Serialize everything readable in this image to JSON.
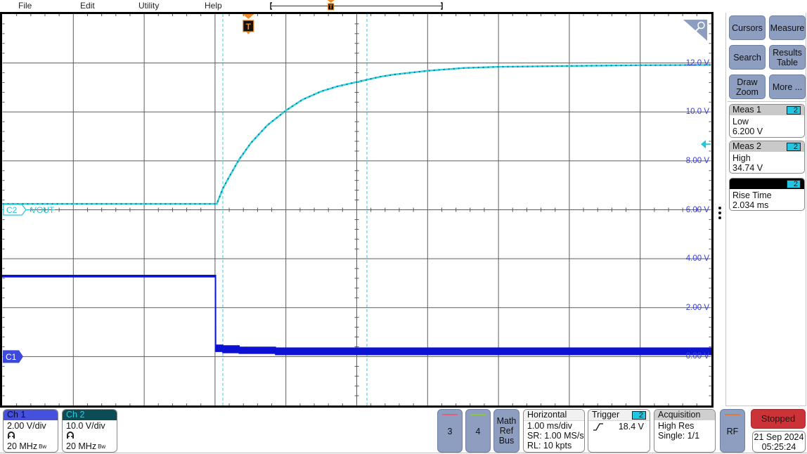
{
  "menu": {
    "file": "File",
    "edit": "Edit",
    "utility": "Utility",
    "help": "Help"
  },
  "record_view": {
    "trigger_position_pct": 35,
    "trigger_marker": "T"
  },
  "plot": {
    "trigger_marker": "T",
    "ch1_marker": "C1",
    "ch2_marker": "C2",
    "ch2_label": "VOUT",
    "zoom_icon": "magnifier-icon",
    "more_icon": "vertical-ellipsis-icon"
  },
  "side_panel": {
    "buttons": [
      {
        "label": "Cursors"
      },
      {
        "label": "Measure"
      },
      {
        "label": "Search"
      },
      {
        "label": "Results\nTable"
      },
      {
        "label": "Draw\nZoom"
      },
      {
        "label": "More ..."
      }
    ],
    "measurements": [
      {
        "title": "Meas 1",
        "source": "2",
        "type": "Low",
        "value": "6.200 V"
      },
      {
        "title": "Meas 2",
        "source": "2",
        "type": "High",
        "value": "34.74 V"
      },
      {
        "title": "",
        "source": "2",
        "type": "Rise Time",
        "value": "2.034 ms"
      }
    ]
  },
  "bottom_bar": {
    "channels": [
      {
        "label": "Ch 1",
        "scale": "2.00 V/div",
        "bandwidth": "20 MHz",
        "bw_symbol": "Bw"
      },
      {
        "label": "Ch 2",
        "scale": "10.0 V/div",
        "bandwidth": "20 MHz",
        "bw_symbol": "Bw"
      }
    ],
    "add_buttons": [
      {
        "label": "3"
      },
      {
        "label": "4"
      },
      {
        "label": "Math\nRef\nBus"
      }
    ],
    "horizontal": {
      "title": "Horizontal",
      "scale": "1.00 ms/div",
      "sample_rate": "SR: 1.00 MS/s",
      "record_length": "RL: 10 kpts"
    },
    "trigger": {
      "title": "Trigger",
      "source": "2",
      "slope": "rising-edge",
      "level": "18.4 V"
    },
    "acquisition": {
      "title": "Acquisition",
      "mode": "High Res",
      "count": "Single: 1/1"
    },
    "rf": {
      "label": "RF"
    },
    "run_state": "Stopped",
    "date": "21 Sep 2024",
    "time": "05:25:24"
  },
  "colors": {
    "ch1": "#0d12d2",
    "ch1_badge": "#4550dc",
    "ch2": "#27d3e6",
    "ch2_noise": "#0e7f86",
    "ch2_badge": "#0b4c55",
    "cursor": "#39c6df",
    "trigger_marker": "#f08a24",
    "axis_label": "#3a3fd4",
    "button": "#8e9ec0",
    "stopped": "#cc3338",
    "ch3_stripe": "#e0607e",
    "ch4_stripe": "#8dc63f",
    "rf_stripe": "#e07a3a"
  },
  "chart_data": {
    "type": "line",
    "title": "",
    "xlabel": "",
    "ylabel": "",
    "x_units": "ms",
    "x_scale_per_div": 1.0,
    "xlim": [
      -3.47,
      6.53
    ],
    "grid": true,
    "y_tick_axis": "C1",
    "y_ticks": [
      {
        "value": 12,
        "label": "12.0 V"
      },
      {
        "value": 10,
        "label": "10.0 V"
      },
      {
        "value": 8,
        "label": "8.00 V"
      },
      {
        "value": 6,
        "label": "6.00 V"
      },
      {
        "value": 4,
        "label": "4.00 V"
      },
      {
        "value": 2,
        "label": "2.00 V"
      },
      {
        "value": 0,
        "label": "0.00 V"
      }
    ],
    "series": [
      {
        "name": "C1",
        "scale_v_per_div": 2.0,
        "ylim": [
          -2,
          14
        ],
        "marker_level_v": 0,
        "color": "#0d12d2",
        "style": "envelope [t, min, max]",
        "points": [
          [
            -3.47,
            3.26,
            3.32
          ],
          [
            -0.462,
            3.26,
            3.32
          ],
          [
            -0.46,
            0.21,
            0.47
          ],
          [
            -0.361,
            0.21,
            0.47
          ],
          [
            -0.36,
            0.16,
            0.44
          ],
          [
            -0.13,
            0.16,
            0.44
          ],
          [
            -0.129,
            0.13,
            0.38
          ],
          [
            0.383,
            0.13,
            0.38
          ],
          [
            0.384,
            0.08,
            0.35
          ],
          [
            6.53,
            0.08,
            0.35
          ]
        ]
      },
      {
        "name": "C2",
        "label": "VOUT",
        "scale_v_per_div": 10.0,
        "ylim": [
          -35,
          45
        ],
        "marker_level_v": 5,
        "color": "#27d3e6",
        "points": [
          [
            -3.47,
            6.2
          ],
          [
            -0.445,
            6.2
          ],
          [
            -0.361,
            9.32
          ],
          [
            -0.262,
            11.95
          ],
          [
            -0.13,
            15.3
          ],
          [
            0.036,
            18.66
          ],
          [
            0.267,
            22.26
          ],
          [
            0.528,
            25.27
          ],
          [
            0.763,
            27.51
          ],
          [
            1.028,
            29.2
          ],
          [
            1.26,
            30.24
          ],
          [
            1.53,
            31.11
          ],
          [
            1.855,
            32.17
          ],
          [
            2.054,
            32.64
          ],
          [
            2.53,
            33.41
          ],
          [
            3.046,
            33.98
          ],
          [
            3.542,
            34.22
          ],
          [
            4.535,
            34.4
          ],
          [
            5.527,
            34.55
          ],
          [
            6.53,
            34.6
          ]
        ]
      }
    ],
    "cursors": {
      "type": "vertical",
      "times": [
        -0.36,
        1.674
      ]
    },
    "trigger": {
      "source": "C2",
      "time": 0,
      "level_v": 18.4,
      "slope": "rising"
    },
    "measurements": {
      "low_v": 6.2,
      "high_v": 34.74,
      "rise_time_ms": 2.034
    }
  }
}
